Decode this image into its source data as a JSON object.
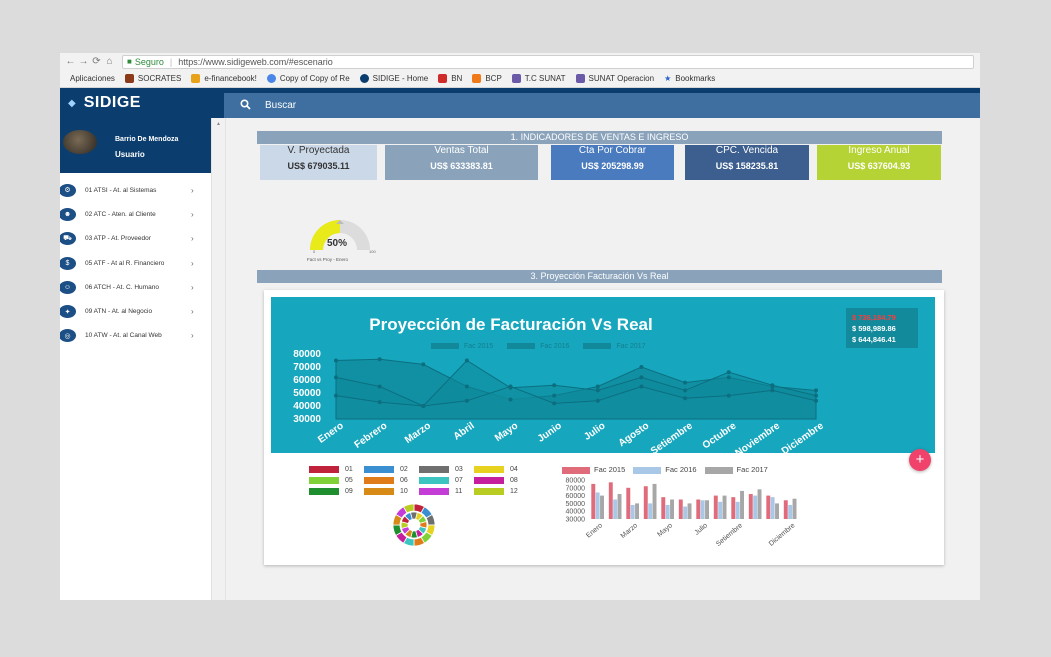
{
  "browser": {
    "secure_label": "Seguro",
    "url": "https://www.sidigeweb.com/#escenario",
    "bookmarks": [
      "Aplicaciones",
      "SOCRATES",
      "e-financebook!",
      "Copy of Copy of Re",
      "SIDIGE - Home",
      "BN",
      "BCP",
      "T.C SUNAT",
      "SUNAT Operacion",
      "Bookmarks"
    ]
  },
  "app": {
    "brand": "SIDIGE",
    "search_label": "Buscar",
    "user_name": "Barrio De Mendoza",
    "user_role": "Usuario",
    "menu": [
      "01 ATSI - At. al Sistemas",
      "02 ATC - Aten. al Cliente",
      "03 ATP - At. Proveedor",
      "05 ATF - At al R. Financiero",
      "06 ATCH - At. C. Humano",
      "09 ATN - At. al Negocio",
      "10 ATW - At. al Canal Web"
    ]
  },
  "sections": {
    "indicadores": "1. INDICADORES DE VENTAS E INGRESO",
    "proyeccion": "3. Proyección Facturación Vs Real"
  },
  "kpis": [
    {
      "label": "V. Proyectada",
      "value": "US$ 679035.11",
      "bg": "#cbd8e8",
      "fg": "#333333"
    },
    {
      "label": "Ventas Total",
      "value": "US$ 633383.81",
      "bg": "#8aa3bb",
      "fg": "#ffffff"
    },
    {
      "label": "Cta Por Cobrar",
      "value": "US$ 205298.99",
      "bg": "#4a7bbf",
      "fg": "#ffffff"
    },
    {
      "label": "CPC. Vencida",
      "value": "US$ 158235.81",
      "bg": "#3c5f8f",
      "fg": "#ffffff"
    },
    {
      "label": "Ingreso Anual",
      "value": "US$ 637604.93",
      "bg": "#b5d334",
      "fg": "#ffffff"
    }
  ],
  "gauge": {
    "value_label": "50%",
    "value": 0.5,
    "min": "0",
    "max": "100",
    "caption": "Fact vs Proy - Enero"
  },
  "main_chart_text": {
    "title": "Proyección de Facturación Vs Real",
    "totals": [
      {
        "text": "$ 736,184.79",
        "color": "#ff3b3b"
      },
      {
        "text": "$ 598,989.86",
        "color": "#ffffff"
      },
      {
        "text": "$ 644,846.41",
        "color": "#ffffff"
      }
    ]
  },
  "chart_data": [
    {
      "type": "area",
      "title": "Proyección de Facturación Vs Real",
      "categories": [
        "Enero",
        "Febrero",
        "Marzo",
        "Abril",
        "Mayo",
        "Junio",
        "Julio",
        "Agosto",
        "Setiembre",
        "Octubre",
        "Noviembre",
        "Diciembre"
      ],
      "series": [
        {
          "name": "Fac 2015",
          "values": [
            75000,
            76000,
            72000,
            55000,
            45000,
            48000,
            55000,
            70000,
            58000,
            62000,
            55000,
            52000
          ]
        },
        {
          "name": "Fac 2016",
          "values": [
            62000,
            55000,
            40000,
            75000,
            54000,
            56000,
            52000,
            62000,
            52000,
            66000,
            56000,
            48000
          ]
        },
        {
          "name": "Fac 2017",
          "values": [
            48000,
            43000,
            40000,
            44000,
            55000,
            42000,
            44000,
            55000,
            46000,
            48000,
            52000,
            44000
          ]
        }
      ],
      "ylim": [
        30000,
        80000
      ],
      "yticks": [
        80000,
        70000,
        60000,
        50000,
        40000,
        30000
      ],
      "legend": "top"
    },
    {
      "type": "pie",
      "categories": [
        "01",
        "02",
        "03",
        "04",
        "05",
        "06",
        "07",
        "08",
        "09",
        "10",
        "11",
        "12"
      ],
      "colors": [
        "#c0223b",
        "#3a8fd0",
        "#6f6f6f",
        "#e6d21f",
        "#7fd137",
        "#e07b1a",
        "#3cc4c0",
        "#c51f9e",
        "#1e8e2e",
        "#d88a16",
        "#c43dd6",
        "#b8cc22"
      ],
      "rings": 2,
      "legend": "top"
    },
    {
      "type": "bar",
      "categories": [
        "Enero",
        "Febrero",
        "Marzo",
        "Abril",
        "Mayo",
        "Junio",
        "Julio",
        "Agosto",
        "Setiembre",
        "Octubre",
        "Noviembre",
        "Diciembre"
      ],
      "tick_labels": [
        "Enero",
        "Marzo",
        "Mayo",
        "Julio",
        "Setiembre",
        "Diciembre"
      ],
      "series": [
        {
          "name": "Fac 2015",
          "color": "#e06b7b",
          "values": [
            75000,
            77000,
            70000,
            72000,
            58000,
            55000,
            55000,
            60000,
            58000,
            62000,
            60000,
            54000
          ]
        },
        {
          "name": "Fac 2016",
          "color": "#a9c8e8",
          "values": [
            64000,
            55000,
            48000,
            50000,
            48000,
            46000,
            54000,
            52000,
            52000,
            60000,
            58000,
            48000
          ]
        },
        {
          "name": "Fac 2017",
          "color": "#a7a7a7",
          "values": [
            60000,
            62000,
            50000,
            75000,
            55000,
            50000,
            54000,
            60000,
            66000,
            68000,
            50000,
            56000
          ]
        }
      ],
      "ylim": [
        30000,
        80000
      ],
      "yticks": [
        80000,
        70000,
        60000,
        50000,
        40000,
        30000
      ],
      "legend": "top"
    }
  ],
  "fab_label": "+"
}
